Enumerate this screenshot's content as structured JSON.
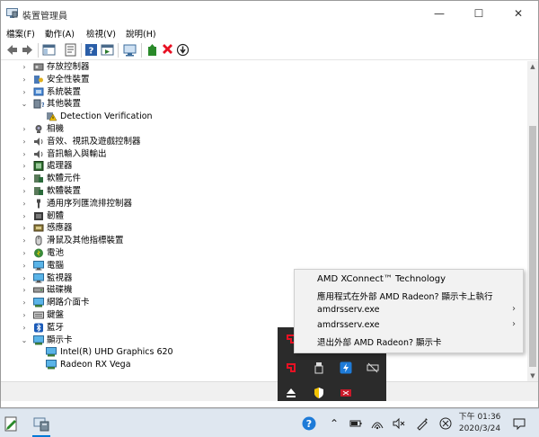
{
  "window": {
    "title": "裝置管理員",
    "min_glyph": "—",
    "max_glyph": "☐",
    "close_glyph": "✕"
  },
  "menu": [
    "檔案(F)",
    "動作(A)",
    "檢視(V)",
    "說明(H)"
  ],
  "tree": [
    {
      "label": "存放控制器",
      "expand": "›",
      "icon": "storage-controller-icon"
    },
    {
      "label": "安全性裝置",
      "expand": "›",
      "icon": "security-device-icon"
    },
    {
      "label": "系統裝置",
      "expand": "›",
      "icon": "system-device-icon"
    },
    {
      "label": "其他裝置",
      "expand": "⌄",
      "icon": "other-devices-icon"
    },
    {
      "label": "Detection Verification",
      "expand": "",
      "icon": "warning-device-icon"
    },
    {
      "label": "相機",
      "expand": "›",
      "icon": "camera-icon"
    },
    {
      "label": "音效、視訊及遊戲控制器",
      "expand": "›",
      "icon": "audio-icon"
    },
    {
      "label": "音訊輸入與輸出",
      "expand": "›",
      "icon": "audio-io-icon"
    },
    {
      "label": "處理器",
      "expand": "›",
      "icon": "processor-icon"
    },
    {
      "label": "軟體元件",
      "expand": "›",
      "icon": "software-component-icon"
    },
    {
      "label": "軟體裝置",
      "expand": "›",
      "icon": "software-device-icon"
    },
    {
      "label": "通用序列匯流排控制器",
      "expand": "›",
      "icon": "usb-icon"
    },
    {
      "label": "韌體",
      "expand": "›",
      "icon": "firmware-icon"
    },
    {
      "label": "感應器",
      "expand": "›",
      "icon": "sensor-icon"
    },
    {
      "label": "滑鼠及其他指標裝置",
      "expand": "›",
      "icon": "mouse-icon"
    },
    {
      "label": "電池",
      "expand": "›",
      "icon": "battery-icon"
    },
    {
      "label": "電腦",
      "expand": "›",
      "icon": "computer-icon"
    },
    {
      "label": "監視器",
      "expand": "›",
      "icon": "monitor-icon"
    },
    {
      "label": "磁碟機",
      "expand": "›",
      "icon": "disk-icon"
    },
    {
      "label": "網路介面卡",
      "expand": "›",
      "icon": "network-icon"
    },
    {
      "label": "鍵盤",
      "expand": "›",
      "icon": "keyboard-icon"
    },
    {
      "label": "藍牙",
      "expand": "›",
      "icon": "bluetooth-icon"
    },
    {
      "label": "顯示卡",
      "expand": "⌄",
      "icon": "display-adapter-icon"
    },
    {
      "label": "Intel(R) UHD Graphics 620",
      "expand": "",
      "icon": "display-adapter-icon"
    },
    {
      "label": "Radeon RX Vega",
      "expand": "",
      "icon": "display-adapter-icon"
    }
  ],
  "context_menu": {
    "title": "AMD XConnect™ Technology",
    "items": [
      {
        "label": "應用程式在外部 AMD Radeon? 顯示卡上執行",
        "submenu": ""
      },
      {
        "label": "amdrsserv.exe",
        "submenu": "›"
      },
      {
        "label": "amdrsserv.exe",
        "submenu": "›"
      },
      {
        "label": "退出外部 AMD Radeon? 顯示卡",
        "submenu": ""
      }
    ]
  },
  "clock": {
    "time": "下午 01:36",
    "date": "2020/3/24"
  },
  "colors": {
    "accent": "#0078d7",
    "taskbar": "#dfe7f0",
    "flyout": "#2b2b2b",
    "error_red": "#e81123"
  }
}
